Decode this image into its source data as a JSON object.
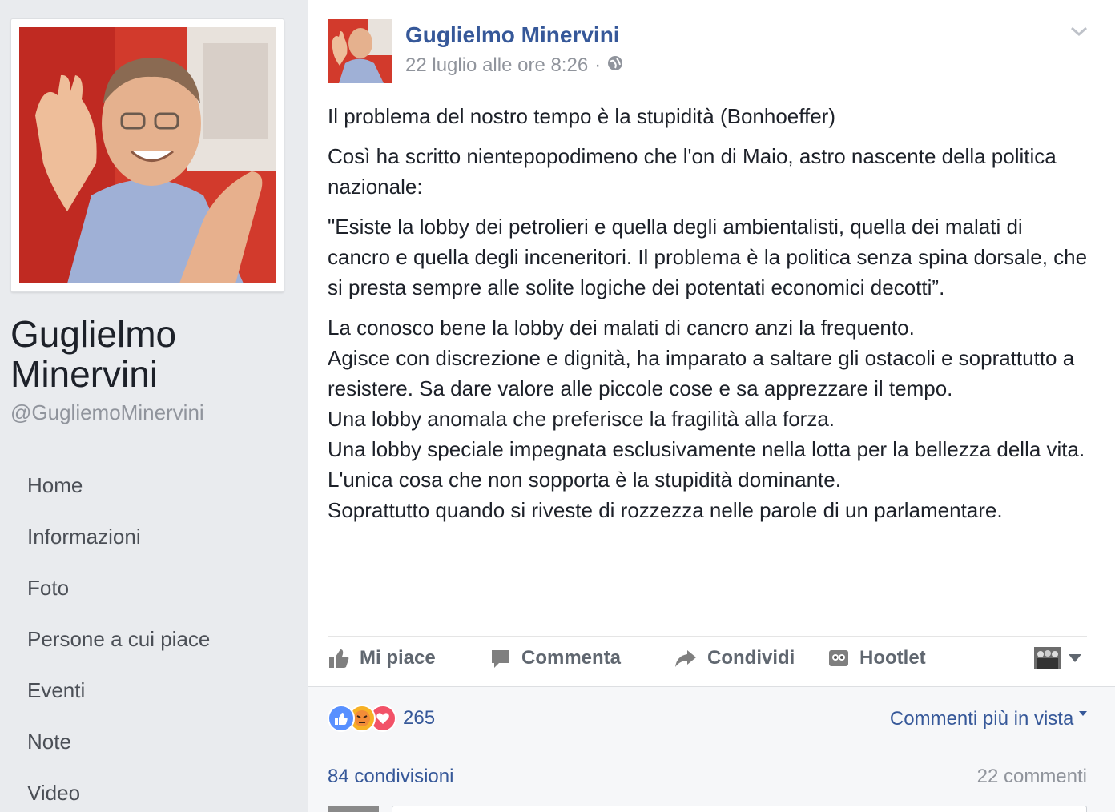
{
  "sidebar": {
    "page_name": "Guglielmo Minervini",
    "handle": "@GugliemoMinervini",
    "nav": [
      "Home",
      "Informazioni",
      "Foto",
      "Persone a cui piace",
      "Eventi",
      "Note",
      "Video"
    ]
  },
  "post": {
    "author": "Guglielmo Minervini",
    "timestamp": "22 luglio alle ore 8:26",
    "separator": "·",
    "paragraphs": [
      "Il problema del nostro tempo è la stupidità (Bonhoeffer)",
      "Così ha scritto nientepopodimeno che l'on di Maio, astro nascente della politica nazionale:",
      "\"Esiste la lobby dei petrolieri e quella degli ambientalisti, quella dei malati di cancro e quella degli inceneritori. Il problema è la politica senza spina dorsale, che si presta sempre alle solite logiche dei potentati economici decotti”."
    ],
    "lines": [
      "La conosco bene la lobby dei malati di cancro anzi la frequento.",
      "Agisce con discrezione e dignità, ha imparato a saltare gli ostacoli e soprattutto a resistere. Sa dare valore alle piccole cose e sa apprezzare il tempo.",
      "Una lobby anomala che preferisce la fragilità alla forza.",
      "Una lobby speciale impegnata esclusivamente nella lotta per la bellezza della vita.",
      "L'unica cosa che non sopporta è la stupidità dominante.",
      "Soprattutto quando si riveste di rozzezza nelle parole di un parlamentare."
    ],
    "actions": {
      "like": "Mi piace",
      "comment": "Commenta",
      "share": "Condividi",
      "hootlet": "Hootlet"
    },
    "reactions_count": "265",
    "sort_label": "Commenti più in vista",
    "shares": "84 condivisioni",
    "comments": "22 commenti"
  },
  "colors": {
    "link": "#365899",
    "like_blue": "#5890ff",
    "angry": "#f7b125",
    "love": "#f25268"
  }
}
